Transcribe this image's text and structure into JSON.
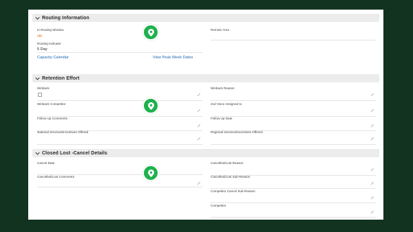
{
  "sections": {
    "routing": {
      "title": "Routing Information",
      "in_routing_window_label": "In Routing Window",
      "in_routing_window_value": "nlk",
      "routing_indicator_label": "Routing Indicator",
      "routing_indicator_value": "5 Day",
      "capacity_calendar_link": "Capacity Calendar",
      "view_peak_week_link": "View Peak Week Dates",
      "remote_area_label": "Remote Area"
    },
    "retention": {
      "title": "Retention Effort",
      "winback_label": "Winback",
      "winback_reason_label": "Winback Reason",
      "winback_competitor_label": "Winback Competitor",
      "second_voice_label": "2nd Voice Assigned to",
      "follow_up_comments_label": "Follow Up Comments",
      "follow_up_date_label": "Follow Up Date",
      "national_services_label": "National Services/Incentives Offered",
      "regional_services_label": "Regional Services/Incentives Offered"
    },
    "closed_lost": {
      "title": "Closed Lost -Cancel Details",
      "cancel_date_label": "Cancel Date",
      "cancelled_lost_reason_label": "Cancelled/Lost Reason",
      "cancelled_lost_comments_label": "Cancelled/Lost Comments",
      "cancelled_lost_sub_reason_label": "Cancelled/Lost Sub-Reason",
      "competitor_cancel_sub_reason_label": "Competitor Cancel Sub-Reason",
      "competitor_label": "Competitor"
    }
  },
  "icons": {
    "section_toggle": "chevron-down-icon",
    "edit": "pencil-icon",
    "marker": "location-pin-icon"
  },
  "colors": {
    "background": "#133321",
    "section_header": "#ececec",
    "link": "#1a64b4",
    "value_orange": "#e0781a",
    "marker": "#1eb14d"
  }
}
